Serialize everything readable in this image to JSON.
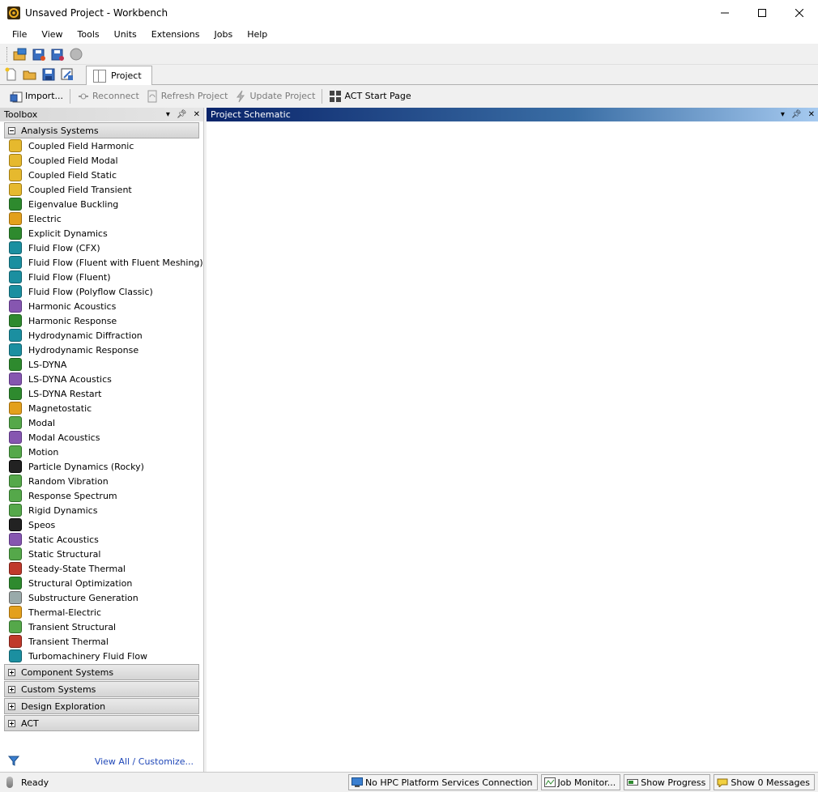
{
  "window": {
    "title": "Unsaved Project - Workbench"
  },
  "menu": [
    "File",
    "View",
    "Tools",
    "Units",
    "Extensions",
    "Jobs",
    "Help"
  ],
  "tabs": {
    "project": "Project"
  },
  "toolbar": {
    "import": "Import...",
    "reconnect": "Reconnect",
    "refresh": "Refresh Project",
    "update": "Update Project",
    "act_start": "ACT Start Page"
  },
  "toolbox": {
    "title": "Toolbox",
    "groups": {
      "analysis": "Analysis Systems",
      "component": "Component Systems",
      "custom": "Custom Systems",
      "design": "Design Exploration",
      "act": "ACT"
    },
    "items": [
      {
        "label": "Coupled Field Harmonic",
        "icon": "coupled-field-icon",
        "color": "yellow"
      },
      {
        "label": "Coupled Field Modal",
        "icon": "coupled-field-icon",
        "color": "yellow"
      },
      {
        "label": "Coupled Field Static",
        "icon": "coupled-field-icon",
        "color": "yellow"
      },
      {
        "label": "Coupled Field Transient",
        "icon": "coupled-field-icon",
        "color": "yellow"
      },
      {
        "label": "Eigenvalue Buckling",
        "icon": "buckling-icon",
        "color": "green"
      },
      {
        "label": "Electric",
        "icon": "electric-icon",
        "color": "orange"
      },
      {
        "label": "Explicit Dynamics",
        "icon": "explicit-icon",
        "color": "green"
      },
      {
        "label": "Fluid Flow (CFX)",
        "icon": "fluid-flow-icon",
        "color": "teal"
      },
      {
        "label": "Fluid Flow (Fluent with Fluent Meshing)",
        "icon": "fluid-flow-icon",
        "color": "teal"
      },
      {
        "label": "Fluid Flow (Fluent)",
        "icon": "fluid-flow-icon",
        "color": "teal"
      },
      {
        "label": "Fluid Flow (Polyflow Classic)",
        "icon": "fluid-flow-icon",
        "color": "teal"
      },
      {
        "label": "Harmonic Acoustics",
        "icon": "acoustics-icon",
        "color": "purple"
      },
      {
        "label": "Harmonic Response",
        "icon": "harmonic-icon",
        "color": "green"
      },
      {
        "label": "Hydrodynamic Diffraction",
        "icon": "hydro-icon",
        "color": "teal"
      },
      {
        "label": "Hydrodynamic Response",
        "icon": "hydro-icon",
        "color": "teal"
      },
      {
        "label": "LS-DYNA",
        "icon": "lsdyna-icon",
        "color": "green"
      },
      {
        "label": "LS-DYNA Acoustics",
        "icon": "acoustics-icon",
        "color": "purple"
      },
      {
        "label": "LS-DYNA Restart",
        "icon": "lsdyna-icon",
        "color": "green"
      },
      {
        "label": "Magnetostatic",
        "icon": "magnet-icon",
        "color": "orange"
      },
      {
        "label": "Modal",
        "icon": "modal-icon",
        "color": "lgreen"
      },
      {
        "label": "Modal Acoustics",
        "icon": "acoustics-icon",
        "color": "purple"
      },
      {
        "label": "Motion",
        "icon": "motion-icon",
        "color": "lgreen"
      },
      {
        "label": "Particle Dynamics (Rocky)",
        "icon": "rocky-icon",
        "color": "black"
      },
      {
        "label": "Random Vibration",
        "icon": "vibration-icon",
        "color": "lgreen"
      },
      {
        "label": "Response Spectrum",
        "icon": "spectrum-icon",
        "color": "lgreen"
      },
      {
        "label": "Rigid Dynamics",
        "icon": "rigid-icon",
        "color": "lgreen"
      },
      {
        "label": "Speos",
        "icon": "speos-icon",
        "color": "black"
      },
      {
        "label": "Static Acoustics",
        "icon": "acoustics-icon",
        "color": "purple"
      },
      {
        "label": "Static Structural",
        "icon": "structural-icon",
        "color": "lgreen"
      },
      {
        "label": "Steady-State Thermal",
        "icon": "thermal-icon",
        "color": "red"
      },
      {
        "label": "Structural Optimization",
        "icon": "optimization-icon",
        "color": "green"
      },
      {
        "label": "Substructure Generation",
        "icon": "substructure-icon",
        "color": "gray"
      },
      {
        "label": "Thermal-Electric",
        "icon": "thermal-electric-icon",
        "color": "orange"
      },
      {
        "label": "Transient Structural",
        "icon": "structural-icon",
        "color": "lgreen"
      },
      {
        "label": "Transient Thermal",
        "icon": "thermal-icon",
        "color": "red"
      },
      {
        "label": "Turbomachinery Fluid Flow",
        "icon": "fluid-flow-icon",
        "color": "teal"
      }
    ],
    "footer_link": "View All / Customize..."
  },
  "schematic": {
    "title": "Project Schematic"
  },
  "status": {
    "ready": "Ready",
    "hpc": "No HPC Platform Services Connection",
    "job_monitor": "Job Monitor...",
    "progress": "Show Progress",
    "messages": "Show 0 Messages"
  }
}
